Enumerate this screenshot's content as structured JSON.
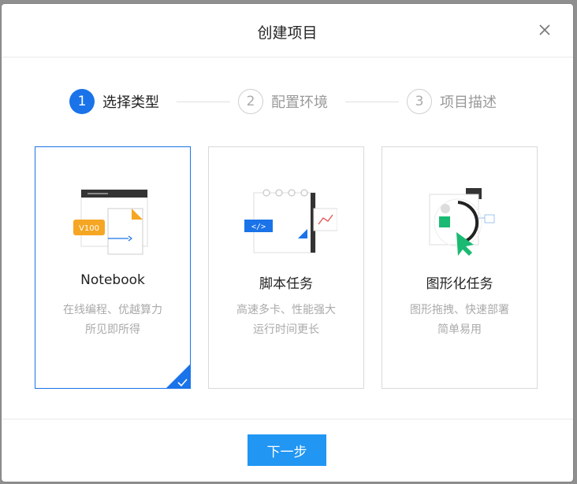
{
  "dialog": {
    "title": "创建项目",
    "close_icon": "close-icon"
  },
  "steps": [
    {
      "number": "1",
      "label": "选择类型",
      "state": "active"
    },
    {
      "number": "2",
      "label": "配置环境",
      "state": "inactive"
    },
    {
      "number": "3",
      "label": "项目描述",
      "state": "inactive"
    }
  ],
  "cards": [
    {
      "title": "Notebook",
      "desc_line1": "在线编程、优越算力",
      "desc_line2": "所见即所得",
      "selected": true,
      "illus_tag": "V100",
      "icon": "notebook-illustration"
    },
    {
      "title": "脚本任务",
      "desc_line1": "高速多卡、性能强大",
      "desc_line2": "运行时间更长",
      "selected": false,
      "illus_tag": "</>",
      "icon": "script-illustration"
    },
    {
      "title": "图形化任务",
      "desc_line1": "图形拖拽、快速部署",
      "desc_line2": "简单易用",
      "selected": false,
      "icon": "graphic-illustration"
    }
  ],
  "footer": {
    "next_label": "下一步"
  },
  "colors": {
    "primary": "#1a73e8",
    "button": "#2196f3",
    "accent_orange": "#f5a623",
    "accent_green": "#1aba73"
  }
}
